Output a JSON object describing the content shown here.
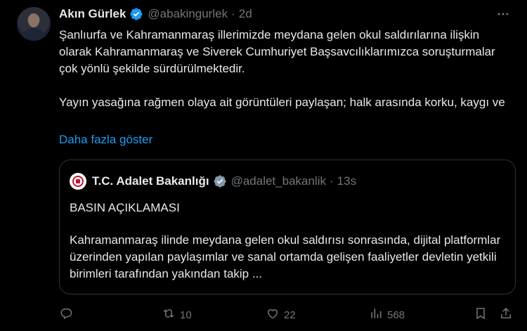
{
  "author": {
    "name": "Akın Gürlek",
    "handle": "@abakingurlek",
    "separator": "·",
    "time": "2d"
  },
  "tweet": {
    "paragraph1": "Şanlıurfa ve Kahramanmaraş illerimizde meydana gelen okul saldırılarına ilişkin olarak Kahramanmaraş ve Siverek Cumhuriyet Başsavcılıklarımızca soruşturmalar çok yönlü şekilde sürdürülmektedir.",
    "paragraph2": "Yayın yasağına rağmen olaya ait görüntüleri paylaşan; halk arasında korku, kaygı ve",
    "show_more": "Daha fazla göster"
  },
  "quote": {
    "name": "T.C. Adalet Bakanlığı",
    "handle": "@adalet_bakanlik",
    "separator": "·",
    "time": "13s",
    "title": "BASIN AÇIKLAMASI",
    "body": "Kahramanmaraş ilinde meydana gelen okul saldırısı sonrasında, dijital platformlar üzerinden yapılan paylaşımlar ve sanal ortamda gelişen faaliyetler devletin yetkili birimleri tarafından yakından takip ..."
  },
  "actions": {
    "reply_count": "",
    "retweet_count": "10",
    "like_count": "22",
    "views_count": "568"
  },
  "colors": {
    "background": "#000000",
    "text": "#e7e9ea",
    "secondary": "#71767b",
    "link": "#1d9bf0",
    "verified": "#1d9bf0",
    "border": "#2f3336"
  },
  "icons": [
    "more-icon",
    "verified-icon",
    "reply-icon",
    "retweet-icon",
    "like-icon",
    "views-icon",
    "bookmark-icon",
    "share-icon"
  ]
}
